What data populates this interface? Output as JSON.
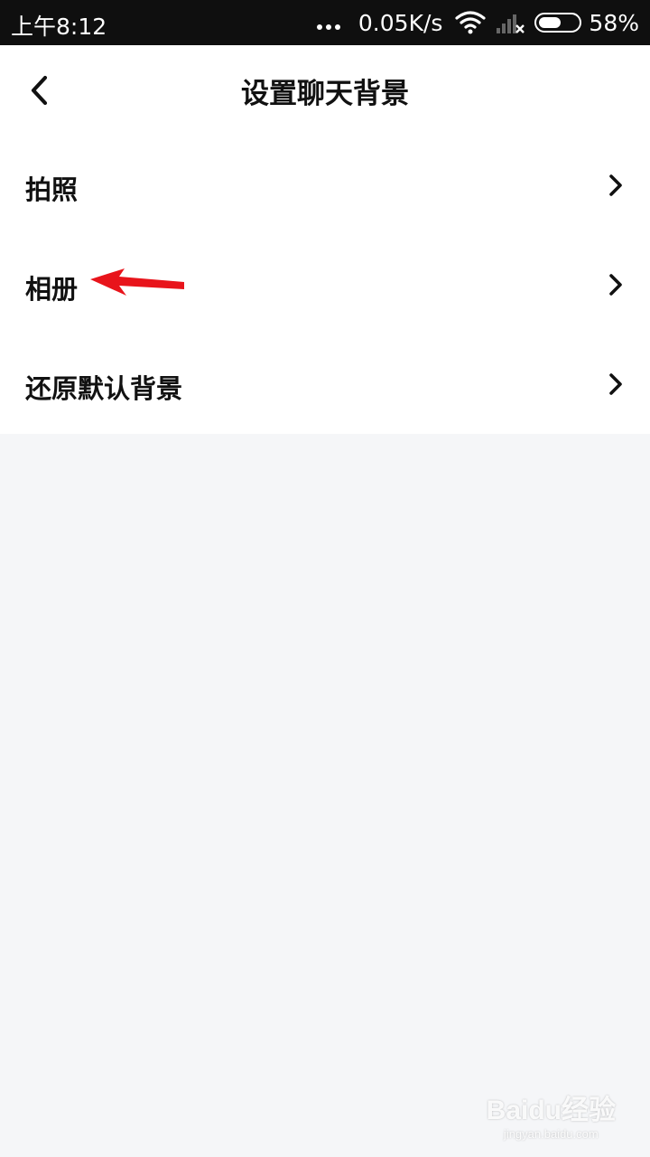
{
  "status_bar": {
    "time": "上午8:12",
    "net_speed": "0.05K/s",
    "battery_percent": "58%",
    "battery_level": 0.58
  },
  "header": {
    "title": "设置聊天背景"
  },
  "menu": {
    "items": [
      {
        "label": "拍照"
      },
      {
        "label": "相册"
      },
      {
        "label": "还原默认背景"
      }
    ]
  },
  "watermark": {
    "main": "Baidu经验",
    "sub": "jingyan.baidu.com"
  },
  "colors": {
    "status_bg": "#0f0f0f",
    "page_bg": "#f5f6f8",
    "menu_bg": "#ffffff",
    "text": "#111111",
    "annotation": "#e8141b"
  }
}
